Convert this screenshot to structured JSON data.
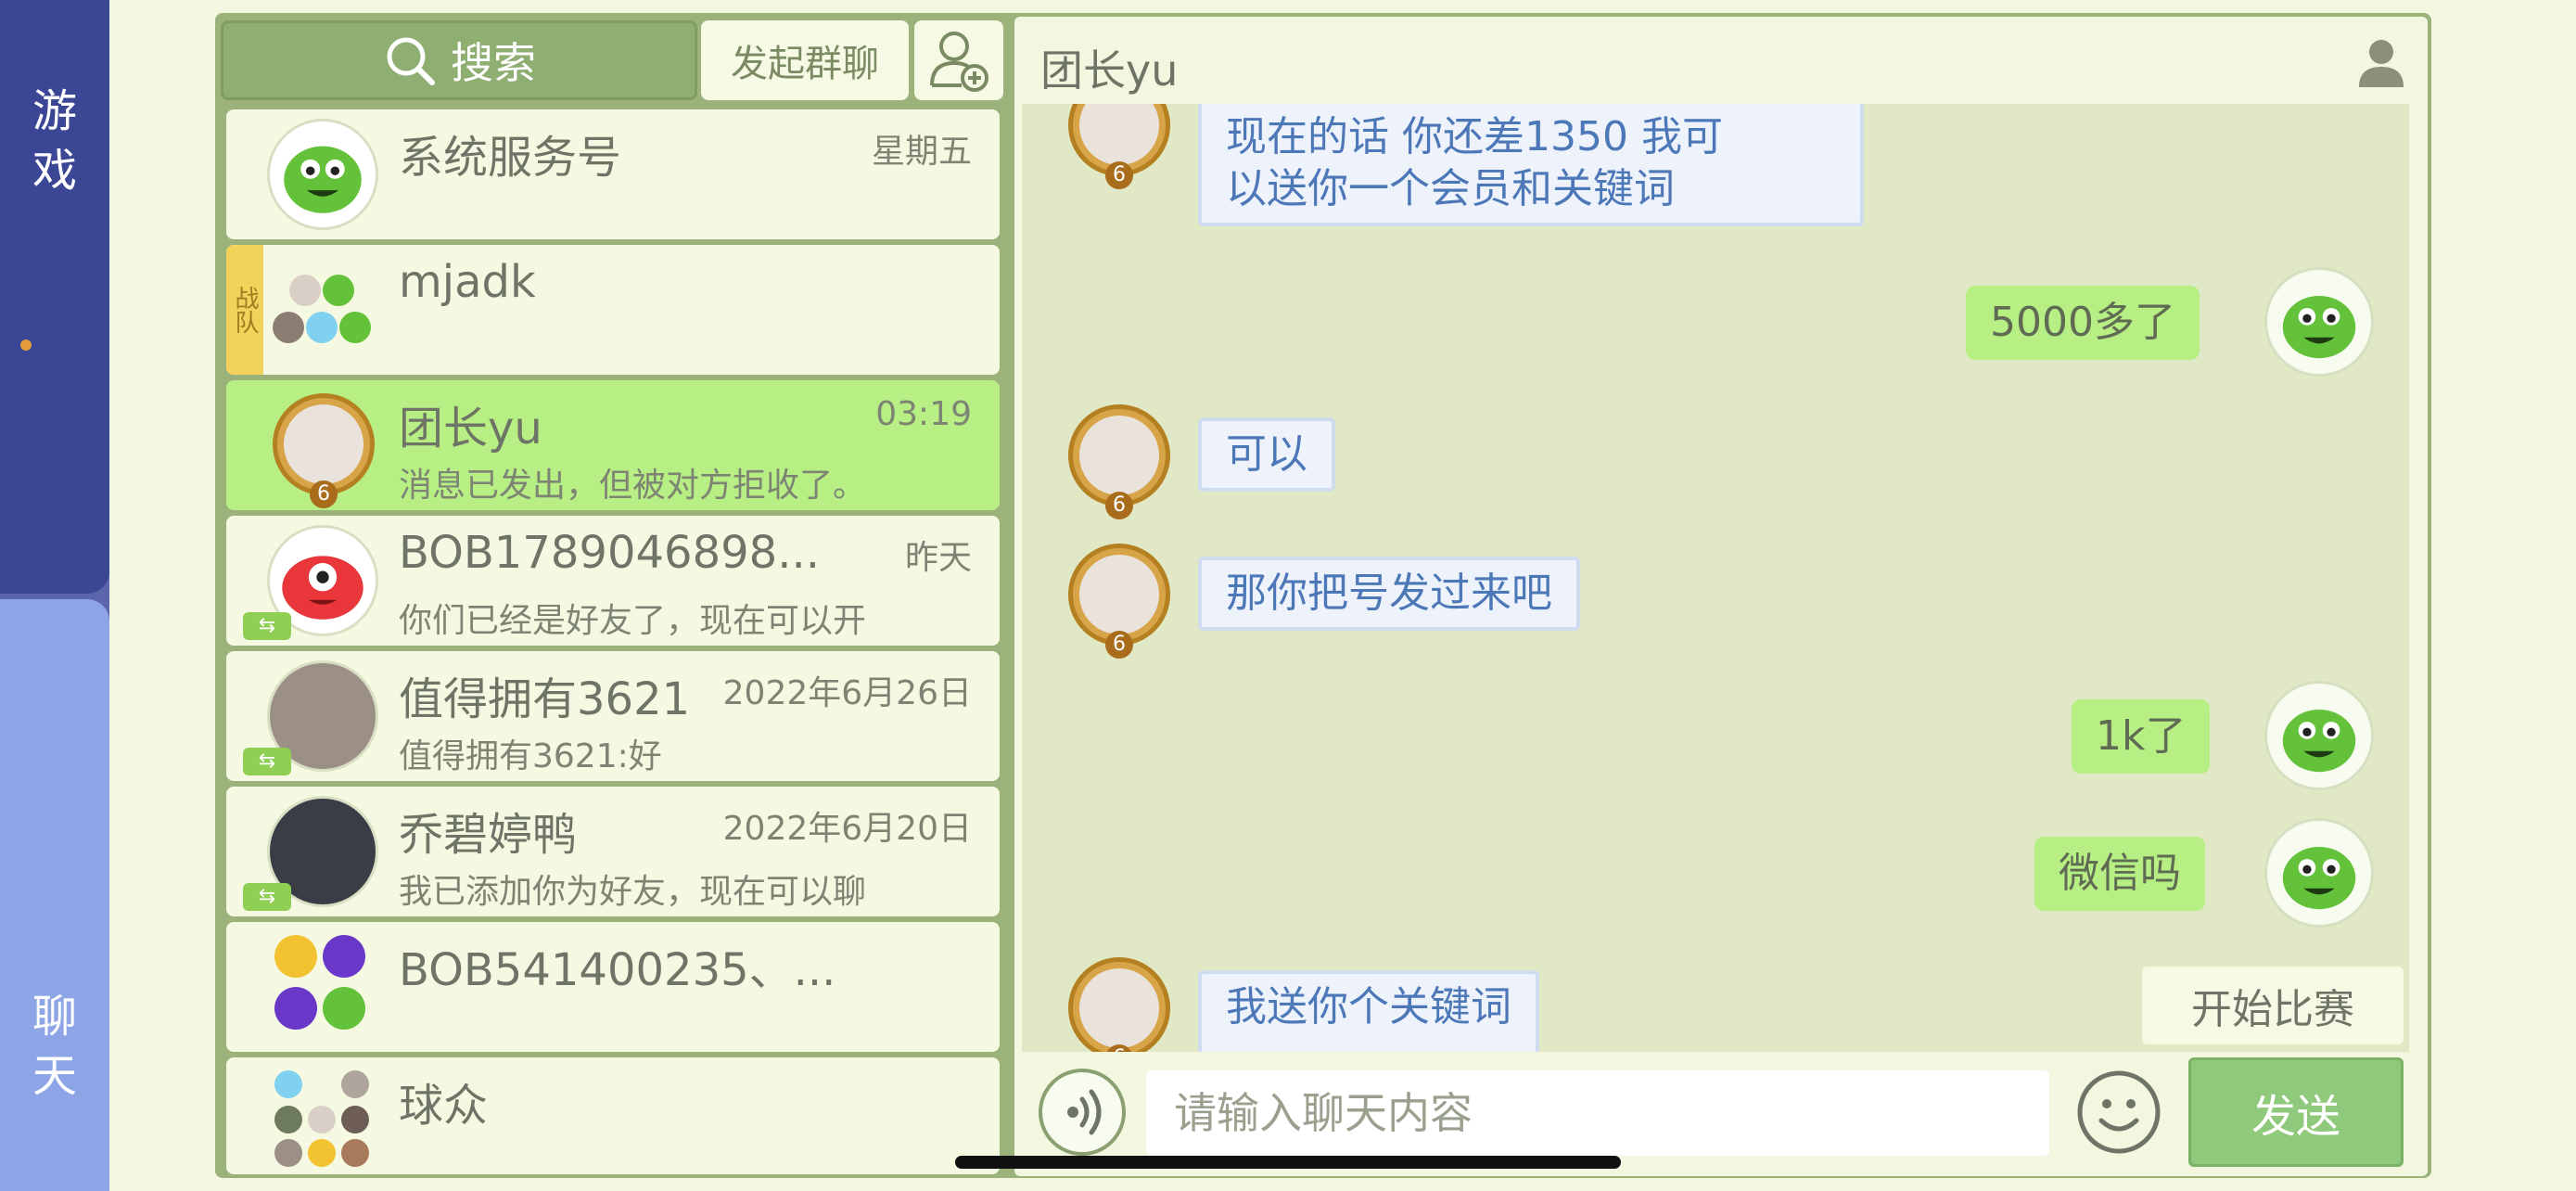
{
  "rail": {
    "games_label_1": "游",
    "games_label_2": "戏",
    "chat_label_1": "聊",
    "chat_label_2": "天"
  },
  "toolbar": {
    "search_label": "搜索",
    "group_chat_label": "发起群聊",
    "add_friend_icon": "add-user-icon"
  },
  "conversations": [
    {
      "name": "系统服务号",
      "time": "星期五",
      "preview": ""
    },
    {
      "name": "mjadk",
      "time": "",
      "preview": "",
      "tag": "战队"
    },
    {
      "name": "团长yu",
      "time": "03:19",
      "preview": "消息已发出，但被对方拒收了。"
    },
    {
      "name": "BOB1789046898...",
      "time": "昨天",
      "preview": "你们已经是好友了，现在可以开"
    },
    {
      "name": "值得拥有3621",
      "time": "2022年6月26日",
      "preview": "值得拥有3621:好"
    },
    {
      "name": "乔碧婷鸭",
      "time": "2022年6月20日",
      "preview": "我已添加你为好友，现在可以聊"
    },
    {
      "name": "BOB541400235、...",
      "time": "",
      "preview": ""
    },
    {
      "name": "球众",
      "time": "",
      "preview": ""
    }
  ],
  "chat": {
    "title": "团长yu",
    "messages": [
      {
        "side": "left",
        "text_1": "现在的话 你还差1350 我可",
        "text_2": "以送你一个会员和关键词"
      },
      {
        "side": "right",
        "text": "5000多了"
      },
      {
        "side": "left",
        "text": "可以"
      },
      {
        "side": "left",
        "text": "那你把号发过来吧"
      },
      {
        "side": "right",
        "text": "1k了"
      },
      {
        "side": "right",
        "text": "微信吗"
      },
      {
        "side": "left",
        "text": "我送你个关键词"
      }
    ],
    "start_match_label": "开始比赛",
    "input_placeholder": "请输入聊天内容",
    "send_label": "发送",
    "avatar_level": "6"
  },
  "colors": {
    "accent_green": "#b7ef84",
    "rail_dark": "#3b4694",
    "rail_light": "#8da4e6",
    "frame": "#9bb27a"
  }
}
